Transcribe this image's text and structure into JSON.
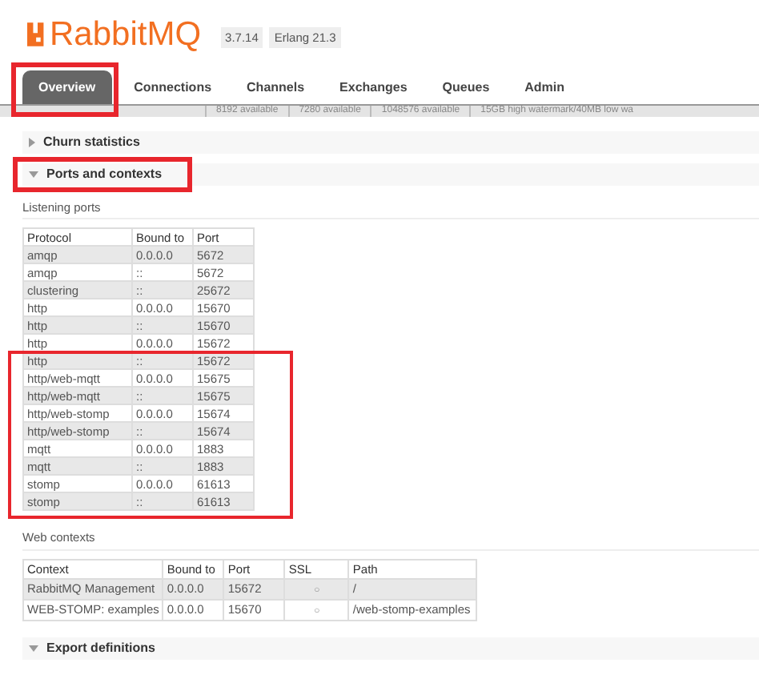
{
  "header": {
    "logo": "RabbitMQ",
    "version": "3.7.14",
    "erlang": "Erlang 21.3"
  },
  "tabs": [
    {
      "label": "Overview",
      "selected": true,
      "highlighted": true
    },
    {
      "label": "Connections",
      "selected": false,
      "highlighted": false
    },
    {
      "label": "Channels",
      "selected": false,
      "highlighted": false
    },
    {
      "label": "Exchanges",
      "selected": false,
      "highlighted": false
    },
    {
      "label": "Queues",
      "selected": false,
      "highlighted": false
    },
    {
      "label": "Admin",
      "selected": false,
      "highlighted": false
    }
  ],
  "hidden_strip": [
    "8192 available",
    "7280 available",
    "1048576 available",
    "15GB high watermark/40MB low wa"
  ],
  "sections": [
    {
      "title": "Churn statistics",
      "expanded": false,
      "highlighted": false
    },
    {
      "title": "Ports and contexts",
      "expanded": true,
      "highlighted": true
    }
  ],
  "listening_ports": {
    "title": "Listening ports",
    "columns": [
      "Protocol",
      "Bound to",
      "Port"
    ],
    "row_groups": [
      {
        "highlighted": false,
        "rows": [
          [
            "amqp",
            "0.0.0.0",
            "5672"
          ],
          [
            "amqp",
            "::",
            "5672"
          ],
          [
            "clustering",
            "::",
            "25672"
          ],
          [
            "http",
            "0.0.0.0",
            "15670"
          ],
          [
            "http",
            "::",
            "15670"
          ],
          [
            "http",
            "0.0.0.0",
            "15672"
          ]
        ]
      },
      {
        "highlighted": true,
        "rows": [
          [
            "http",
            "::",
            "15672"
          ],
          [
            "http/web-mqtt",
            "0.0.0.0",
            "15675"
          ],
          [
            "http/web-mqtt",
            "::",
            "15675"
          ],
          [
            "http/web-stomp",
            "0.0.0.0",
            "15674"
          ],
          [
            "http/web-stomp",
            "::",
            "15674"
          ],
          [
            "mqtt",
            "0.0.0.0",
            "1883"
          ],
          [
            "mqtt",
            "::",
            "1883"
          ],
          [
            "stomp",
            "0.0.0.0",
            "61613"
          ],
          [
            "stomp",
            "::",
            "61613"
          ]
        ]
      }
    ]
  },
  "web_contexts": {
    "title": "Web contexts",
    "columns": [
      "Context",
      "Bound to",
      "Port",
      "SSL",
      "Path"
    ],
    "rows": [
      {
        "context": "RabbitMQ Management",
        "bound_to": "0.0.0.0",
        "port": "15672",
        "ssl": "○",
        "path": "/"
      },
      {
        "context": "WEB-STOMP: examples",
        "bound_to": "0.0.0.0",
        "port": "15670",
        "ssl": "○",
        "path": "/web-stomp-examples"
      }
    ]
  },
  "footer_section": {
    "title": "Export definitions",
    "expanded": true
  }
}
